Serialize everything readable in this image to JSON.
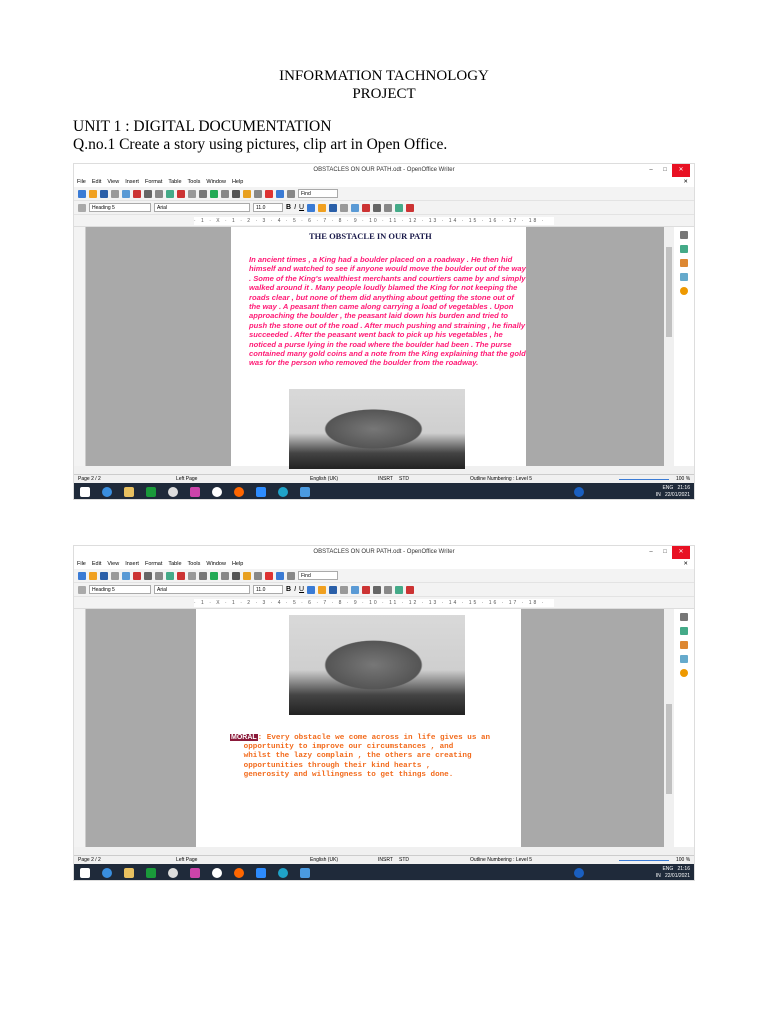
{
  "heading": {
    "line1": "INFORMATION TACHNOLOGY",
    "line2": "PROJECT",
    "unit": "UNIT 1 : DIGITAL DOCUMENTATION",
    "question": "Q.no.1 Create a story using pictures, clip art in Open Office."
  },
  "window": {
    "title": "OBSTACLES ON OUR PATH.odt - OpenOffice Writer",
    "menu": [
      "File",
      "Edit",
      "View",
      "Insert",
      "Format",
      "Table",
      "Tools",
      "Window",
      "Help"
    ],
    "style": "Heading 5",
    "font": "Arial",
    "size": "11.0",
    "find": "Find",
    "ruler": "· 1 · X · 1 · 2 · 3 · 4 · 5 · 6 · 7 · 8 · 9 · 10 · 11 · 12 · 13 · 14 · 15 · 16 · 17 · 18 ·"
  },
  "status": {
    "page": "Page 2 / 2",
    "pagestyle": "Left Page",
    "lang": "English (UK)",
    "insrt": "INSRT",
    "std": "STD",
    "outline": "Outline Numbering : Level 5",
    "zoom": "100 %"
  },
  "tray": {
    "lang1": "ENG",
    "lang2": "IN",
    "time": "21:16",
    "date": "22/01/2021"
  },
  "doc": {
    "title": "THE OBSTACLE IN OUR PATH",
    "story": "In ancient times , a King had a boulder placed on a roadway . He then hid himself and watched to see if anyone would move the boulder out of the way . Some of the King's wealthiest merchants and courtiers came by and simply walked around it . Many people loudly blamed the King for not keeping the roads clear , but none of them did anything about getting the stone out of the way . A peasant then came along carrying a load of vegetables . Upon approaching the boulder , the peasant laid down his burden and tried to push the stone out of the road . After much pushing and straining , he finally succeeded . After the peasant went back to pick up his vegetables , he noticed a purse lying in the road where the boulder had been . The purse contained many gold coins and a note from the King explaining that the gold was for the person who removed the boulder from the roadway.",
    "moral_label": "MORAL",
    "moral": ": Every obstacle we come across in life gives us an\n   opportunity to improve our circumstances , and\n   whilst the lazy complain , the others are creating\n   opportunities through their kind hearts ,\n   generosity and willingness to get things done."
  }
}
